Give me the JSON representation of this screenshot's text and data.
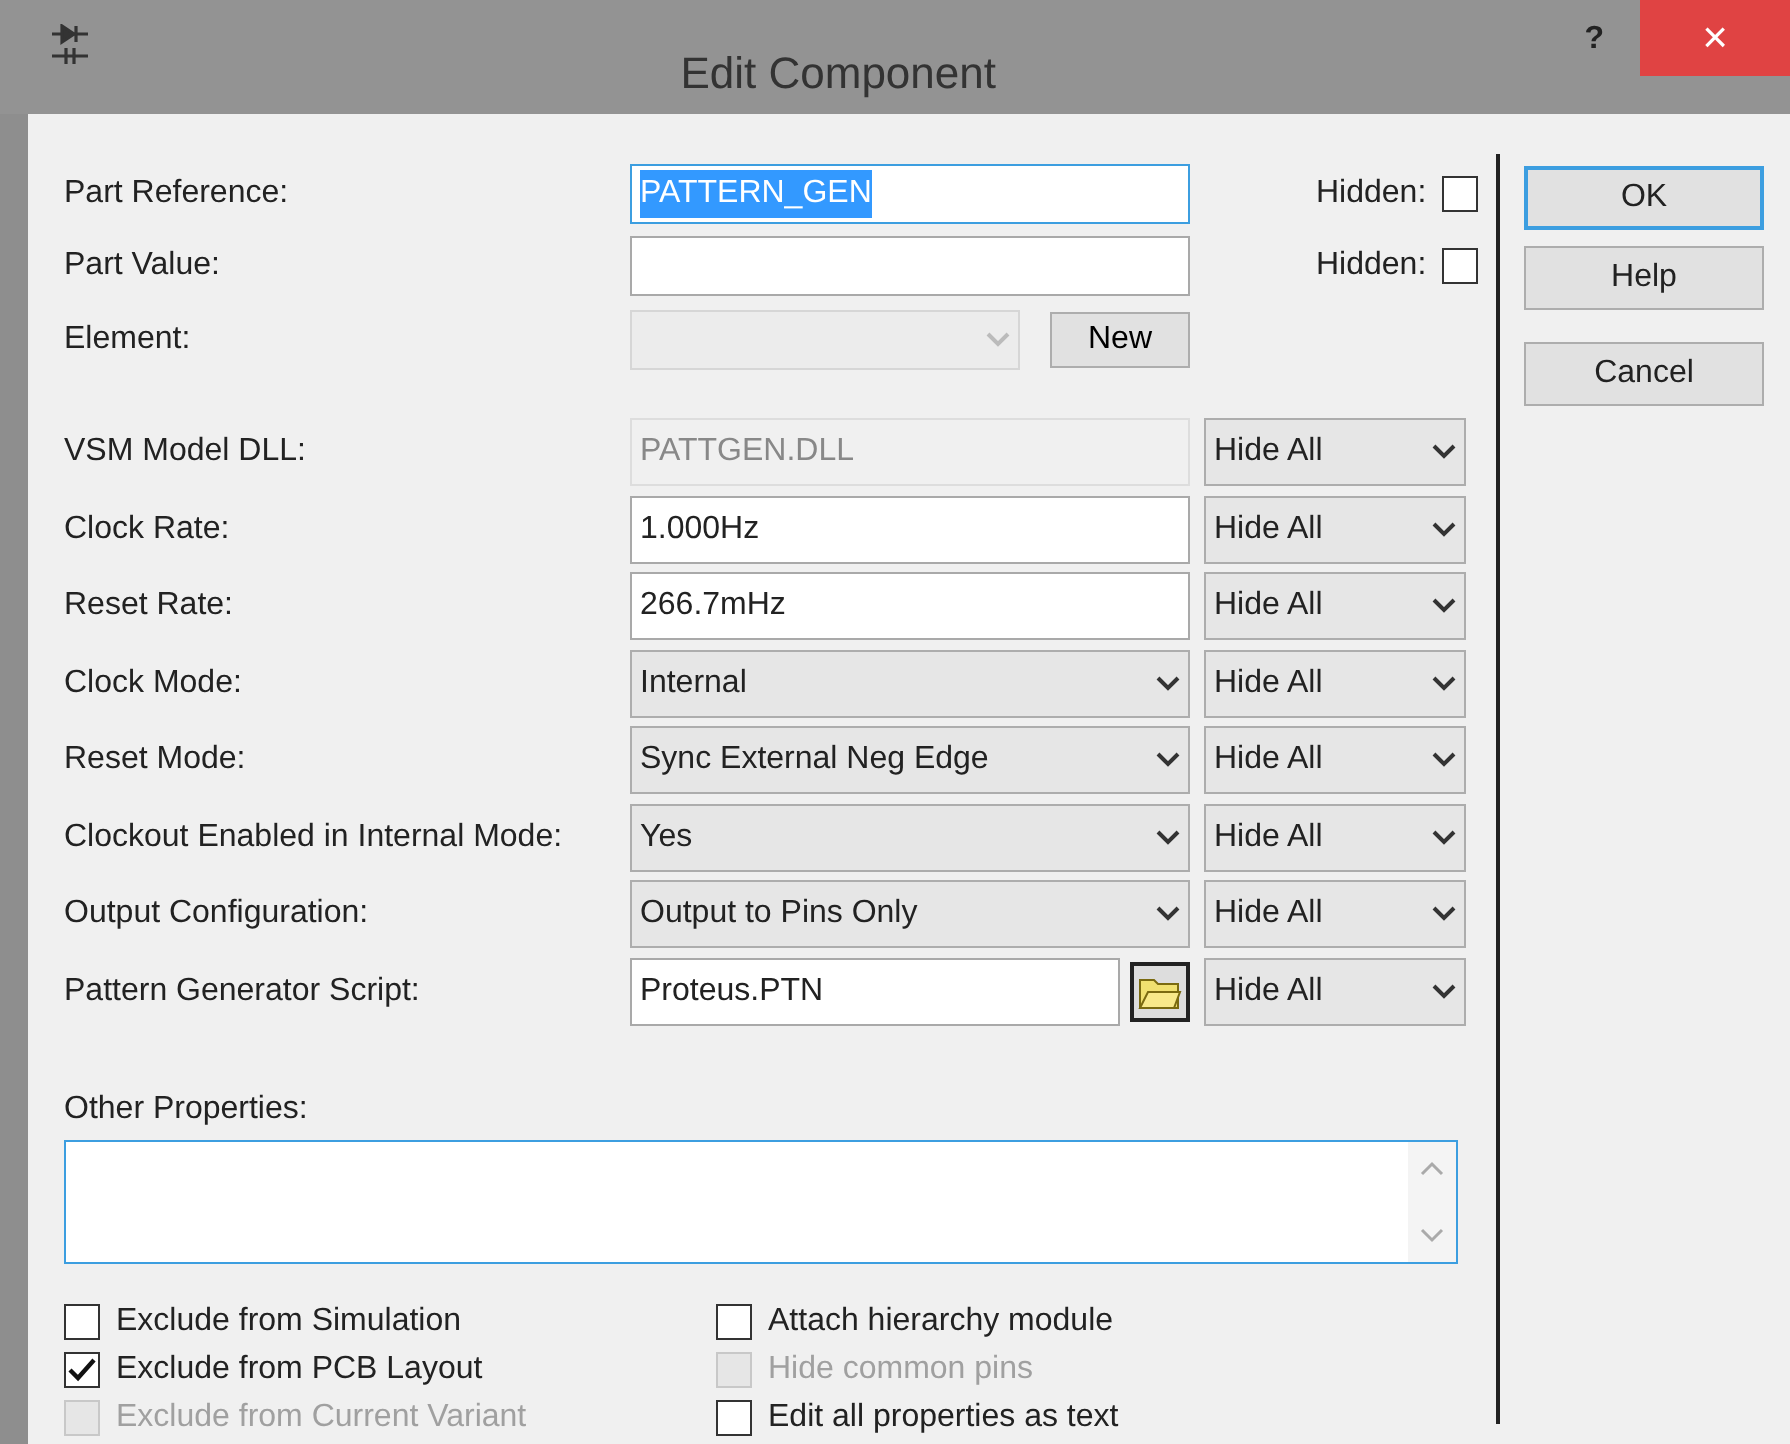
{
  "window": {
    "title": "Edit Component",
    "help_glyph": "?",
    "close_glyph": "×"
  },
  "top_fields": [
    {
      "label": "Part Reference:",
      "value": "PATTERN_GEN",
      "text_selected": true,
      "focused": true,
      "hidden_label": "Hidden:",
      "hidden_checked": false
    },
    {
      "label": "Part Value:",
      "focused": false,
      "hidden_label": "Hidden:",
      "hidden_checked": false
    }
  ],
  "element": {
    "label": "Element:",
    "disabled": true,
    "button": "New"
  },
  "properties": [
    {
      "kind": "readonly",
      "label": "VSM Model DLL:",
      "value": "PATTGEN.DLL",
      "visibility": "Hide All"
    },
    {
      "kind": "text",
      "label": "Clock Rate:",
      "value": "1.000Hz",
      "visibility": "Hide All"
    },
    {
      "kind": "text",
      "label": "Reset Rate:",
      "value": "266.7mHz",
      "visibility": "Hide All"
    },
    {
      "kind": "select",
      "label": "Clock Mode:",
      "value": "Internal",
      "visibility": "Hide All"
    },
    {
      "kind": "select",
      "label": "Reset Mode:",
      "value": "Sync External Neg Edge",
      "visibility": "Hide All"
    },
    {
      "kind": "select",
      "label": "Clockout Enabled in Internal Mode:",
      "value": "Yes",
      "visibility": "Hide All"
    },
    {
      "kind": "select",
      "label": "Output Configuration:",
      "value": "Output to Pins Only",
      "visibility": "Hide All"
    },
    {
      "kind": "file",
      "label": "Pattern Generator Script:",
      "value": "Proteus.PTN",
      "visibility": "Hide All"
    }
  ],
  "other_properties": {
    "label": "Other Properties:"
  },
  "left_checks": [
    {
      "label": "Exclude from Simulation",
      "checked": false,
      "disabled": false
    },
    {
      "label": "Exclude from PCB Layout",
      "checked": true,
      "disabled": false
    },
    {
      "label": "Exclude from Current Variant",
      "checked": false,
      "disabled": true
    }
  ],
  "right_checks": [
    {
      "label": "Attach hierarchy module",
      "checked": false,
      "disabled": false
    },
    {
      "label": "Hide common pins",
      "checked": false,
      "disabled": true
    },
    {
      "label": "Edit all properties as text",
      "checked": false,
      "disabled": false
    }
  ],
  "buttons": [
    {
      "label": "OK",
      "default": true
    },
    {
      "label": "Help",
      "default": false
    },
    {
      "label": "Cancel",
      "default": false
    }
  ]
}
